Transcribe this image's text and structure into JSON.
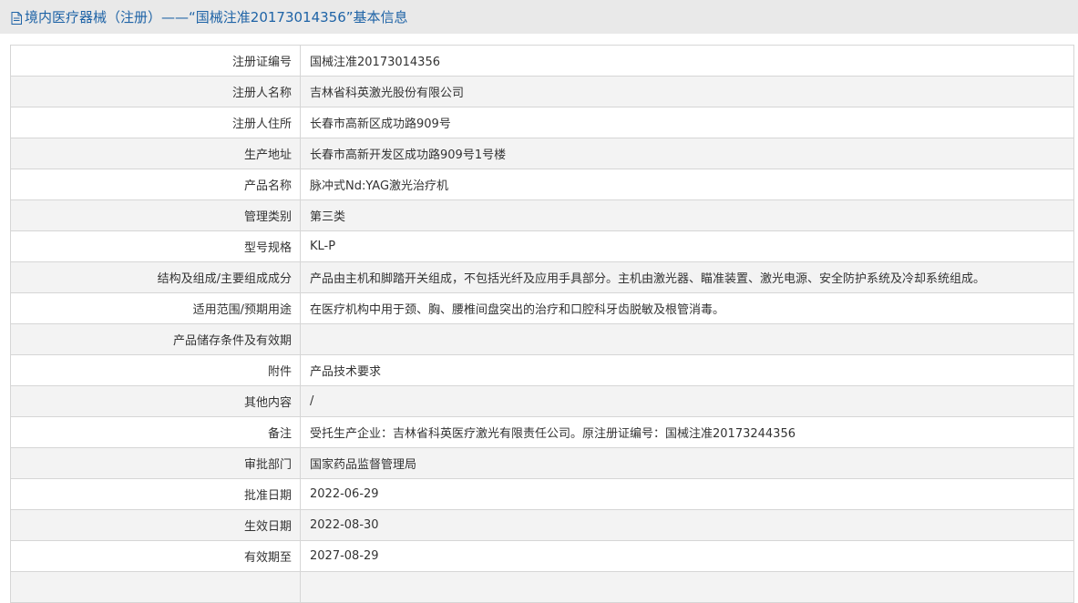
{
  "header": {
    "icon": "document-icon",
    "title": "境内医疗器械（注册）——“国械注准20173014356”基本信息"
  },
  "colors": {
    "accent": "#1e63a6",
    "header_bg": "#e9e9e9",
    "row_alt": "#f3f3f3",
    "border": "#d6d6d6"
  },
  "rows": [
    {
      "label": "注册证编号",
      "value": "国械注准20173014356"
    },
    {
      "label": "注册人名称",
      "value": "吉林省科英激光股份有限公司"
    },
    {
      "label": "注册人住所",
      "value": "长春市高新区成功路909号"
    },
    {
      "label": "生产地址",
      "value": "长春市高新开发区成功路909号1号楼"
    },
    {
      "label": "产品名称",
      "value": "脉冲式Nd:YAG激光治疗机"
    },
    {
      "label": "管理类别",
      "value": "第三类"
    },
    {
      "label": "型号规格",
      "value": "KL-P"
    },
    {
      "label": "结构及组成/主要组成成分",
      "value": "产品由主机和脚踏开关组成，不包括光纤及应用手具部分。主机由激光器、瞄准装置、激光电源、安全防护系统及冷却系统组成。"
    },
    {
      "label": "适用范围/预期用途",
      "value": "在医疗机构中用于颈、胸、腰椎间盘突出的治疗和口腔科牙齿脱敏及根管消毒。"
    },
    {
      "label": "产品储存条件及有效期",
      "value": ""
    },
    {
      "label": "附件",
      "value": "产品技术要求"
    },
    {
      "label": "其他内容",
      "value": "/"
    },
    {
      "label": "备注",
      "value": "受托生产企业：吉林省科英医疗激光有限责任公司。原注册证编号：国械注准20173244356"
    },
    {
      "label": "审批部门",
      "value": "国家药品监督管理局"
    },
    {
      "label": "批准日期",
      "value": "2022-06-29"
    },
    {
      "label": "生效日期",
      "value": "2022-08-30"
    },
    {
      "label": "有效期至",
      "value": "2027-08-29"
    },
    {
      "label": "",
      "value": ""
    }
  ]
}
